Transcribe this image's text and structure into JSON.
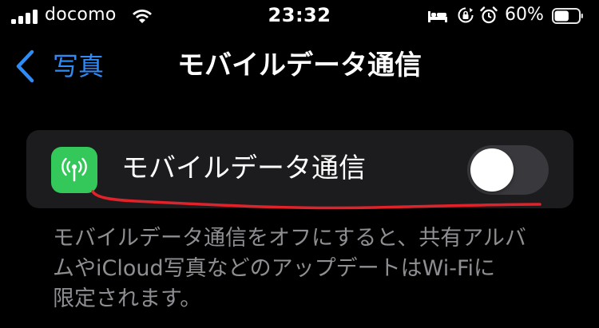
{
  "status_bar": {
    "carrier": "docomo",
    "time": "23:32",
    "battery_percent": "60%",
    "battery_level": 0.6,
    "icons": [
      "signal-bars-icon",
      "wifi-icon",
      "bed-icon",
      "rotation-lock-icon",
      "alarm-icon",
      "battery-icon"
    ]
  },
  "nav": {
    "back_label": "写真",
    "title": "モバイルデータ通信"
  },
  "setting": {
    "icon": "cellular-antenna-icon",
    "label": "モバイルデータ通信",
    "toggle_on": false
  },
  "footer": {
    "line1": "モバイルデータ通信をオフにすると、共有アルバ",
    "line2": "ムやiCloud写真などのアップデートはWi-Fiに",
    "line3": "限定されます。"
  },
  "colors": {
    "background": "#000000",
    "cell_background": "#1c1c1e",
    "accent_blue": "#2f8cf7",
    "icon_green": "#34c759",
    "toggle_off": "#39393d",
    "footer_gray": "#8e8e93",
    "annotation_red": "#e0232b"
  }
}
